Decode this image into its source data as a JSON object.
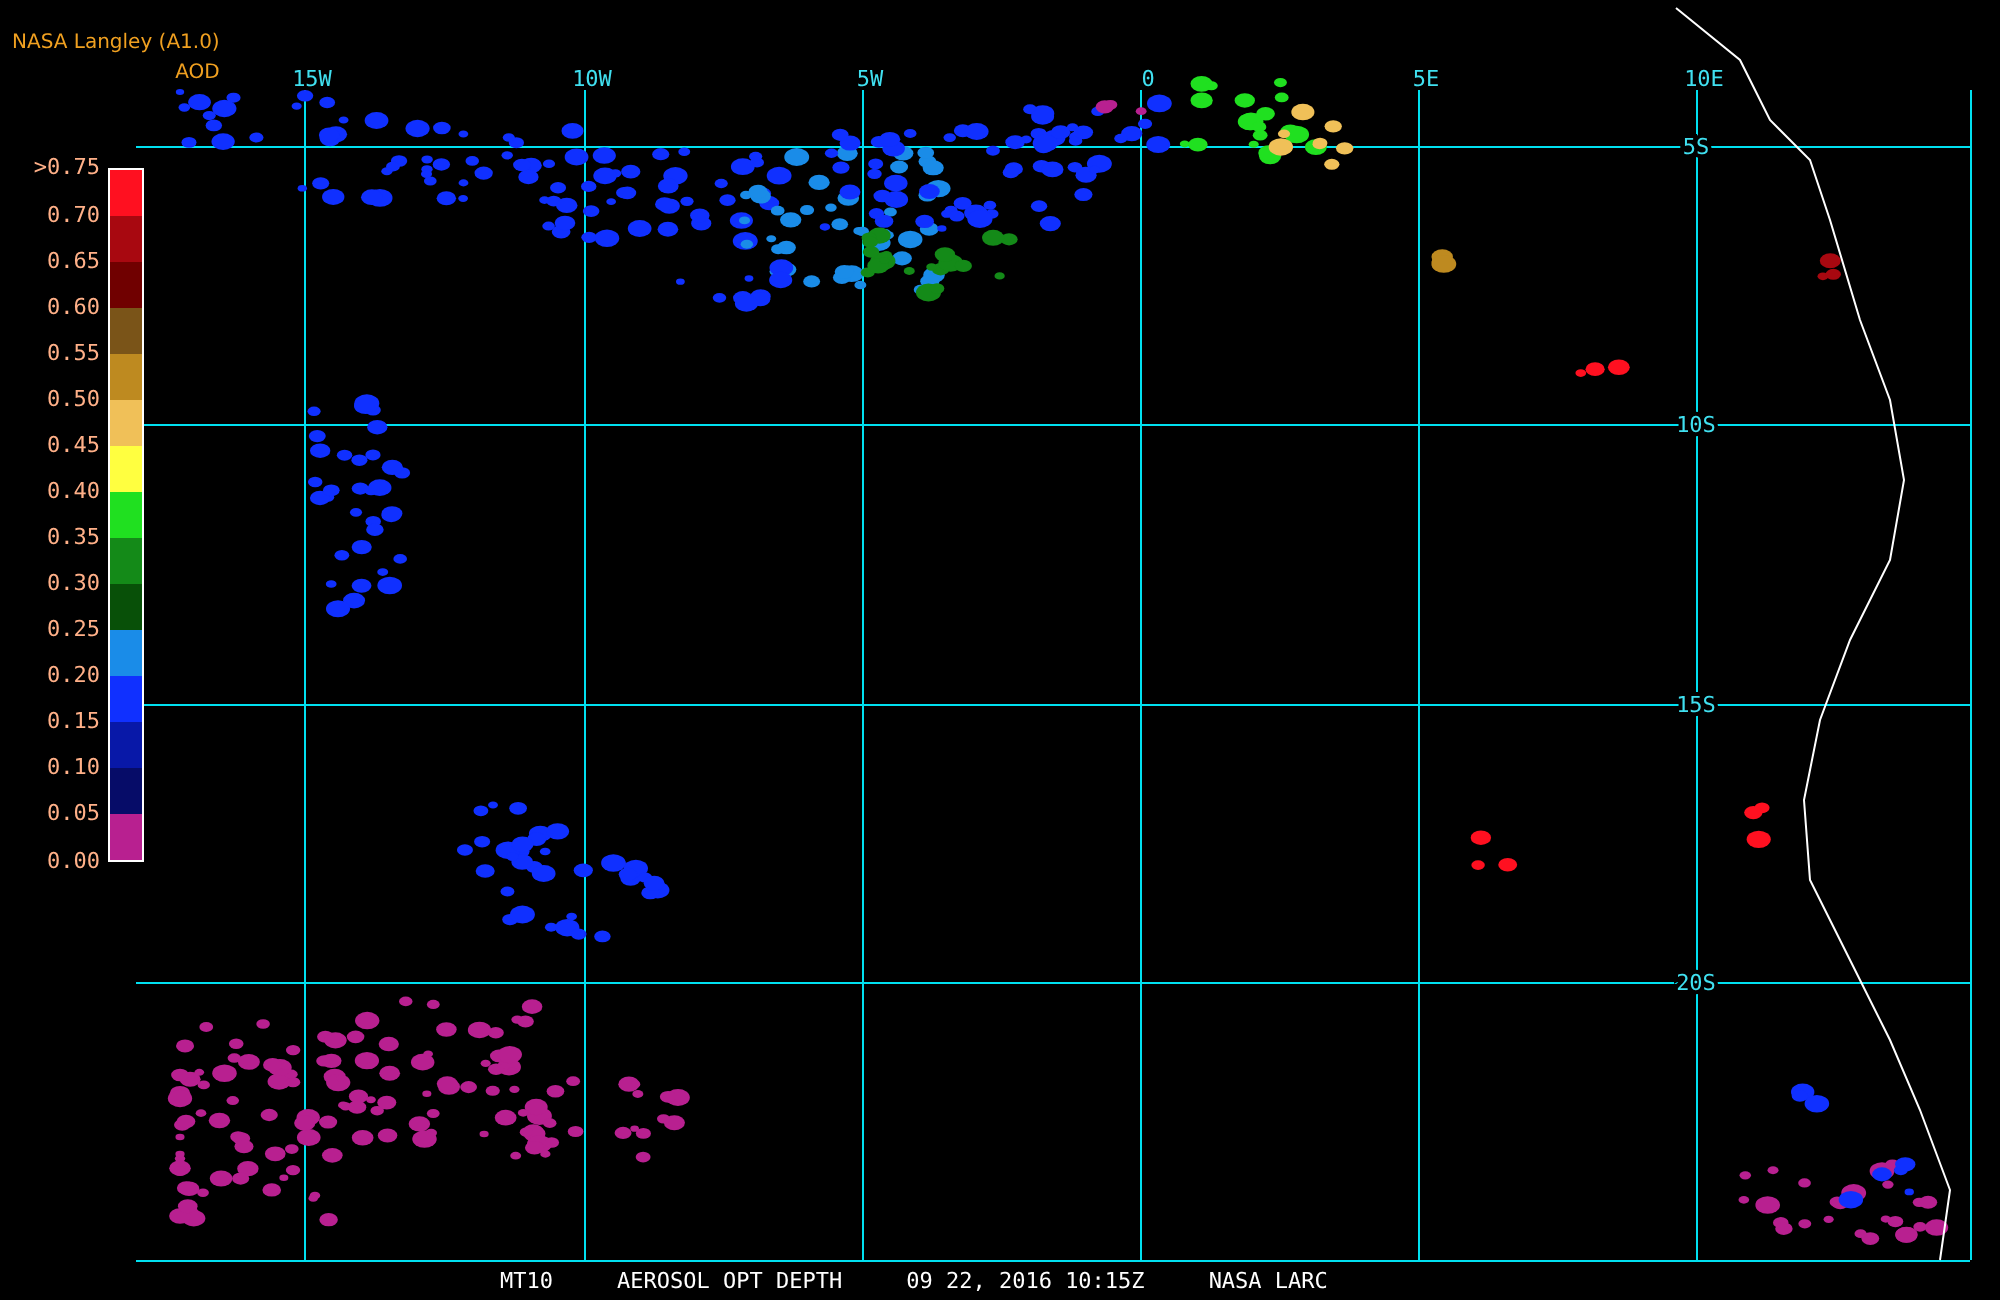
{
  "header": {
    "title": "NASA Langley (A1.0)",
    "variable": "AOD"
  },
  "legend": [
    {
      "label": ">0.75",
      "color": "#ff1020"
    },
    {
      "label": "0.70",
      "color": "#a80810"
    },
    {
      "label": "0.65",
      "color": "#700000"
    },
    {
      "label": "0.60",
      "color": "#7a5418"
    },
    {
      "label": "0.55",
      "color": "#be8a20"
    },
    {
      "label": "0.50",
      "color": "#f0c058"
    },
    {
      "label": "0.45",
      "color": "#ffff40"
    },
    {
      "label": "0.40",
      "color": "#20e020"
    },
    {
      "label": "0.35",
      "color": "#148a18"
    },
    {
      "label": "0.30",
      "color": "#085008"
    },
    {
      "label": "0.25",
      "color": "#1a8ce8"
    },
    {
      "label": "0.20",
      "color": "#1030ff"
    },
    {
      "label": "0.15",
      "color": "#0818a8"
    },
    {
      "label": "0.10",
      "color": "#060c68"
    },
    {
      "label": "0.05",
      "color": "#b82090"
    }
  ],
  "legend_bottom_label": "0.00",
  "map": {
    "lon_labels": [
      "15W",
      "10W",
      "5W",
      "0",
      "5E",
      "10E"
    ],
    "lat_labels": [
      "5S",
      "10S",
      "15S",
      "20S"
    ]
  },
  "caption": [
    "MT10",
    "AEROSOL OPT DEPTH",
    "09 22, 2016 10:15Z",
    "NASA LARC"
  ]
}
